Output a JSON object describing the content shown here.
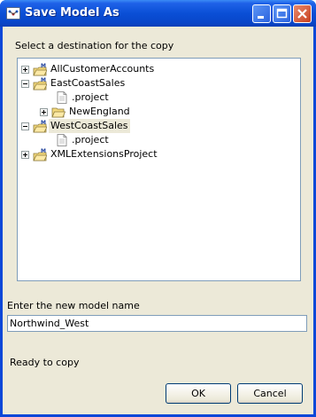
{
  "window": {
    "title": "Save Model As"
  },
  "titlebar_buttons": [
    {
      "name": "minimize",
      "icon": "minimize-icon"
    },
    {
      "name": "maximize",
      "icon": "maximize-icon"
    },
    {
      "name": "close",
      "icon": "close-icon"
    }
  ],
  "destination_label": "Select a destination for the copy",
  "tree": {
    "items": [
      {
        "label": "AllCustomerAccounts",
        "icon": "model-project-icon",
        "expander": "+"
      },
      {
        "label": "EastCoastSales",
        "icon": "model-project-icon",
        "expander": "-"
      },
      {
        "label": ".project",
        "icon": "file-icon",
        "expander": ""
      },
      {
        "label": "NewEngland",
        "icon": "folder-icon",
        "expander": "+"
      },
      {
        "label": "WestCoastSales",
        "icon": "model-project-icon",
        "expander": "-",
        "selected": true
      },
      {
        "label": ".project",
        "icon": "file-icon",
        "expander": ""
      },
      {
        "label": "XMLExtensionsProject",
        "icon": "model-project-icon",
        "expander": "+"
      }
    ]
  },
  "name_label": "Enter the new model name",
  "name_value": "Northwind_West",
  "status": "Ready to copy",
  "buttons": {
    "ok": "OK",
    "cancel": "Cancel"
  },
  "colors": {
    "titlebar": "#0a4fd6",
    "dialog_bg": "#ece9d8",
    "tree_border": "#7f9db9",
    "selection_bg": "#ece9d8"
  }
}
